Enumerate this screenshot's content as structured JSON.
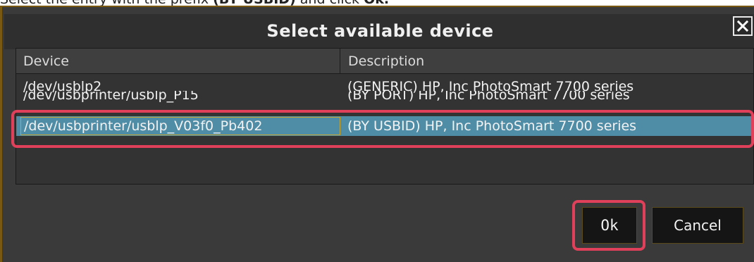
{
  "instruction": {
    "prefix": "Select the entry with the prefix ",
    "bold_term": "(BY USBID)",
    "middle": " and click ",
    "bold_action": "Ok."
  },
  "dialog": {
    "title": "Select available device",
    "close_icon": "close-icon"
  },
  "table": {
    "columns": [
      "Device",
      "Description"
    ],
    "rows": [
      {
        "device": "/dev/usblp2",
        "description": "(GENERIC) HP, Inc PhotoSmart 7700 series"
      },
      {
        "device": "/dev/usbprinter/usblp_P15",
        "description": "(BY PORT) HP, Inc PhotoSmart 7700 series"
      },
      {
        "device": "/dev/usbprinter/usblp_V03f0_Pb402",
        "description": "(BY USBID) HP, Inc PhotoSmart 7700 series"
      }
    ],
    "selected_row": 2
  },
  "buttons": {
    "ok": "Ok",
    "cancel": "Cancel"
  },
  "colors": {
    "selection": "#4f8da6",
    "highlight_annotation": "#e0405a",
    "dialog_bg": "#3a3a3a"
  }
}
